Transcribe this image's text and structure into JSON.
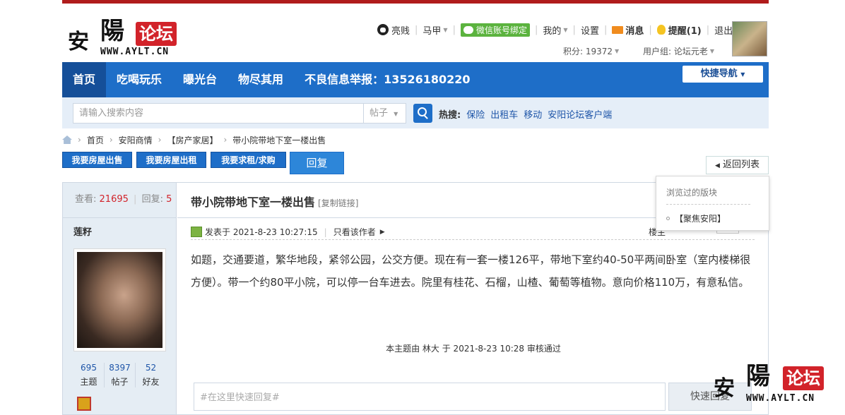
{
  "logo": {
    "char1": "安",
    "char2": "陽",
    "badge": "论坛",
    "url": "WWW.AYLT.CN"
  },
  "user_menu": {
    "username": "亮贱",
    "alt_account": "马甲",
    "wechat_bind": "微信账号绑定",
    "mine": "我的",
    "settings": "设置",
    "messages": "消息",
    "reminder": "提醒(1)",
    "logout": "退出",
    "points": "积分: 19372",
    "usergroup": "用户组: 论坛元老"
  },
  "nav": {
    "items": [
      "首页",
      "吃喝玩乐",
      "曝光台",
      "物尽其用",
      "不良信息举报：13526180220"
    ],
    "quick_nav": "快捷导航"
  },
  "search": {
    "placeholder": "请输入搜索内容",
    "type": "帖子",
    "hot_label": "热搜:",
    "hot_links": [
      "保险",
      "出租车",
      "移动",
      "安阳论坛客户端"
    ]
  },
  "breadcrumb": [
    "首页",
    "安阳商情",
    "【房产家居】",
    "带小院带地下室一楼出售"
  ],
  "actions": {
    "sell": "我要房屋出售",
    "rent": "我要房屋出租",
    "seek": "我要求租/求购",
    "reply": "回复",
    "back": "返回列表"
  },
  "dropdown": {
    "title": "浏览过的版块",
    "item": "【聚焦安阳】"
  },
  "thread": {
    "views_label": "查看:",
    "views": "21695",
    "replies_label": "回复:",
    "replies": "5",
    "title": "带小院带地下室一楼出售",
    "copy_link": "[复制链接]"
  },
  "author": {
    "name": "莲籽",
    "stats": [
      {
        "value": "695",
        "label": "主题"
      },
      {
        "value": "8397",
        "label": "帖子"
      },
      {
        "value": "52",
        "label": "好友"
      }
    ]
  },
  "post": {
    "posted": "发表于 2021-8-23 10:27:15",
    "only_author": "只看该作者",
    "floor_label": "楼主",
    "content": "如题，交通要道，繁华地段，紧邻公园，公交方便。现在有一套一楼126平，带地下室约40-50平两间卧室（室内楼梯很方便）。带一个约80平小院，可以停一台车进去。院里有桂花、石榴，山楂、葡萄等植物。意向价格110万，有意私信。",
    "audit": "本主题由 林大 于 2021-8-23 10:28 审核通过"
  },
  "quick_reply": {
    "placeholder": "#在这里快速回复#",
    "button": "快速回复"
  }
}
